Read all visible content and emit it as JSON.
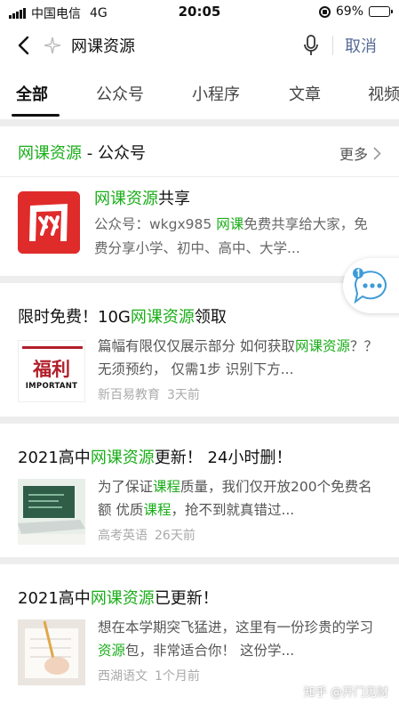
{
  "status_bar": {
    "carrier": "中国电信",
    "network": "4G",
    "time": "20:05",
    "battery": "69%",
    "battery_level": 0.69
  },
  "search": {
    "query": "网课资源",
    "cancel_label": "取消"
  },
  "tabs": [
    {
      "label": "全部",
      "active": true
    },
    {
      "label": "公众号",
      "active": false
    },
    {
      "label": "小程序",
      "active": false
    },
    {
      "label": "文章",
      "active": false
    },
    {
      "label": "视频",
      "active": false
    }
  ],
  "official_accounts": {
    "title_highlight": "网课资源",
    "title_suffix": " - 公众号",
    "more_label": "更多",
    "account": {
      "name_highlight": "网课资源",
      "name_suffix": "共享",
      "logo_text": "网",
      "desc_prefix": "公众号：wkgx985 ",
      "desc_highlight": "网课",
      "desc_suffix": "免费共享给大家，免费分享小学、初中、高中、大学..."
    }
  },
  "articles": [
    {
      "title_pre": "限时免费！10G",
      "title_highlight": "网课资源",
      "title_post": "领取",
      "summary_pre": "篇幅有限仅仅展示部分 如何获取",
      "summary_highlight": "网课资源",
      "summary_post": "？？无须预约， 仅需1步 识别下方...",
      "source": "新百易教育",
      "time": "3天前",
      "thumb_main": "福利",
      "thumb_sub": "IMPORTANT"
    },
    {
      "title_pre": "2021高中",
      "title_highlight": "网课资源",
      "title_post": "更新！ 24小时删！",
      "summary_pre": "为了保证",
      "summary_highlight": "课程",
      "summary_mid": "质量，我们仅开放200个免费名额 优质",
      "summary_highlight2": "课程",
      "summary_post": "，抢不到就真错过...",
      "source": "高考英语",
      "time": "26天前"
    },
    {
      "title_pre": "2021高中",
      "title_highlight": "网课资源",
      "title_post": "已更新！",
      "summary_pre": "想在本学期突飞猛进，这里有一份珍贵的学习",
      "summary_highlight": "资源",
      "summary_post": "包，非常适合你！ 这份学...",
      "source": "西湖语文",
      "time": "1个月前"
    }
  ],
  "watermark": "知乎 @开门见财",
  "colors": {
    "highlight": "#1aad19",
    "cancel": "#576b95",
    "logo_red": "#e02b2b"
  }
}
